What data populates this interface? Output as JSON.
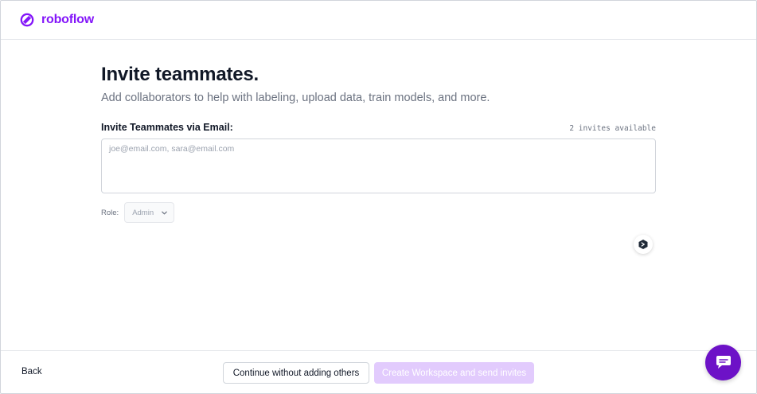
{
  "brand": {
    "name": "roboflow",
    "color": "#8315f9"
  },
  "page": {
    "title": "Invite teammates.",
    "subtitle": "Add collaborators to help with labeling, upload data, train models, and more."
  },
  "invite_form": {
    "field_label": "Invite Teammates via Email:",
    "invites_available": "2 invites available",
    "email_value": "",
    "email_placeholder": "joe@email.com, sara@email.com",
    "role_label": "Role:",
    "role_value": "Admin"
  },
  "footer": {
    "back_label": "Back",
    "continue_label": "Continue without adding others",
    "create_label": "Create Workspace and send invites",
    "create_color": "#e2cbfd"
  },
  "icons": {
    "logo": "roboflow-logo-icon",
    "help": "help-widget-icon",
    "chat": "chat-bubble-icon",
    "chevron": "chevron-down-icon"
  },
  "colors": {
    "chat_fab": "#6d12c7"
  }
}
